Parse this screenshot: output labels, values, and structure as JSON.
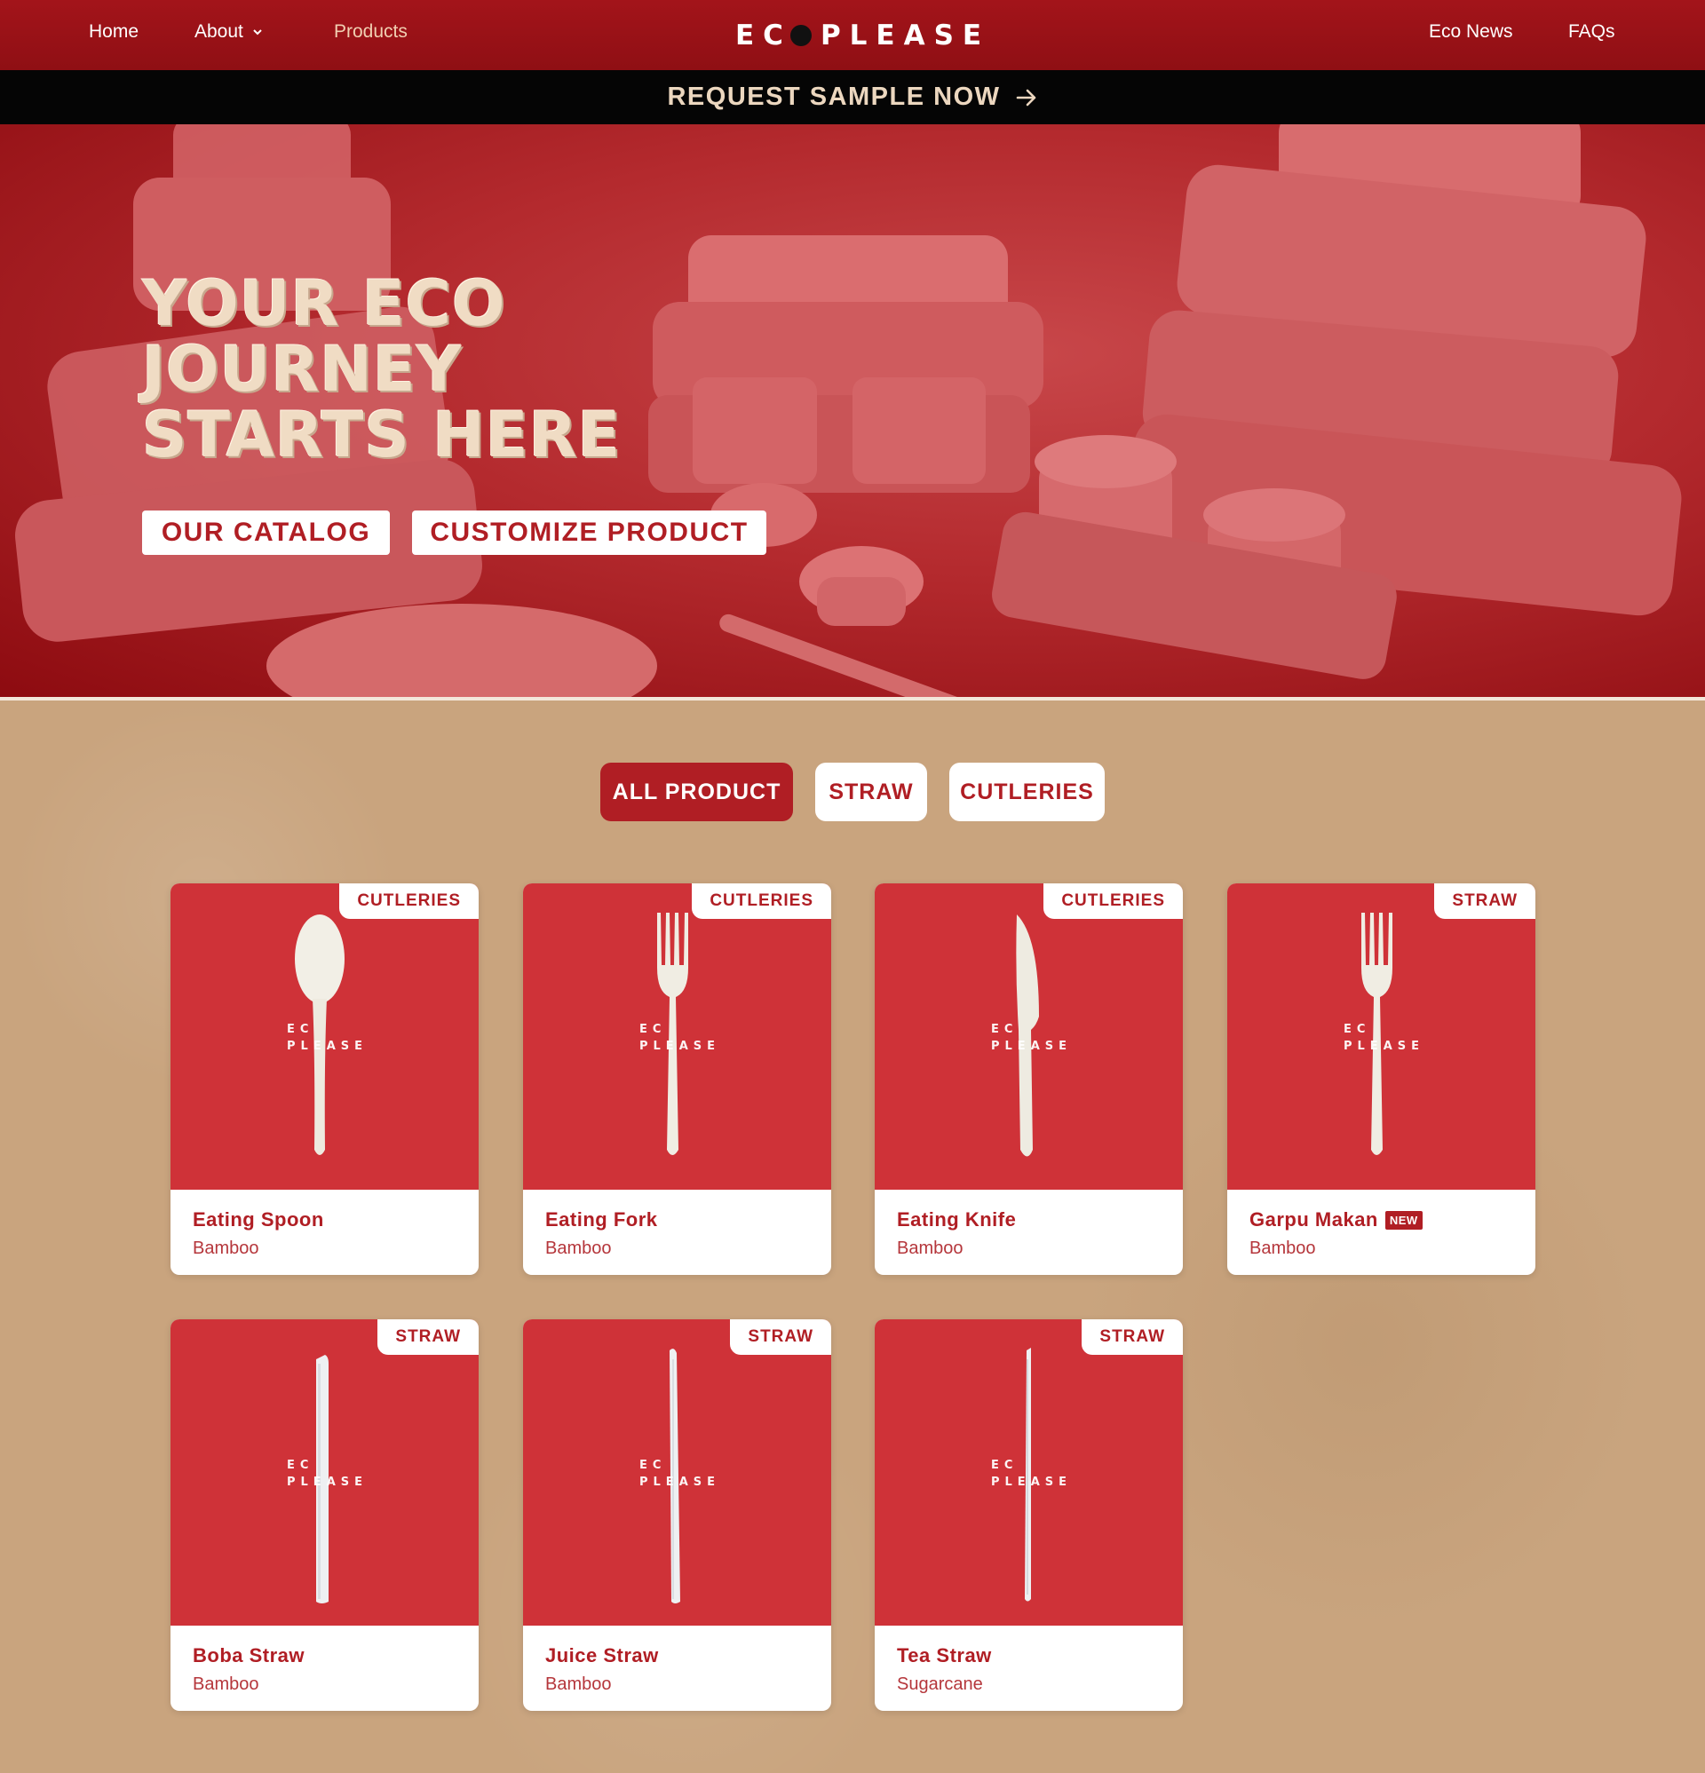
{
  "nav": {
    "home": "Home",
    "about": "About",
    "products": "Products",
    "brand_left": "EC",
    "brand_right": "PLEASE",
    "eco_news": "Eco News",
    "faqs": "FAQs"
  },
  "promo": {
    "label": "REQUEST SAMPLE NOW"
  },
  "hero": {
    "title_line1": "YOUR ECO",
    "title_line2": "JOURNEY",
    "title_line3": "STARTS HERE",
    "catalog_button": "OUR CATALOG",
    "customize_button": "CUSTOMIZE PRODUCT"
  },
  "filters": {
    "all": "ALL PRODUCT",
    "straw": "STRAW",
    "cutleries": "CUTLERIES",
    "selected": "ALL PRODUCT"
  },
  "watermark": {
    "line1": "EC",
    "line2": "PLEASE"
  },
  "products": [
    {
      "name": "Eating Spoon",
      "material": "Bamboo",
      "category": "CUTLERIES",
      "icon": "spoon-icon",
      "is_new": false
    },
    {
      "name": "Eating Fork",
      "material": "Bamboo",
      "category": "CUTLERIES",
      "icon": "fork-icon",
      "is_new": false
    },
    {
      "name": "Eating Knife",
      "material": "Bamboo",
      "category": "CUTLERIES",
      "icon": "knife-icon",
      "is_new": false
    },
    {
      "name": "Garpu Makan",
      "material": "Bamboo",
      "category": "STRAW",
      "icon": "fork-icon",
      "is_new": true,
      "new_label": "NEW"
    },
    {
      "name": "Boba Straw",
      "material": "Bamboo",
      "category": "STRAW",
      "icon": "straw-icon",
      "is_new": false
    },
    {
      "name": "Juice Straw",
      "material": "Bamboo",
      "category": "STRAW",
      "icon": "straw-icon",
      "is_new": false
    },
    {
      "name": "Tea Straw",
      "material": "Sugarcane",
      "category": "STRAW",
      "icon": "straw-icon",
      "is_new": false
    }
  ],
  "colors": {
    "brand_red": "#b01e24",
    "header_red": "#9c1318",
    "card_red": "#cf3238",
    "promo_text": "#ecd7bf",
    "kraft": "#c9a47e"
  }
}
